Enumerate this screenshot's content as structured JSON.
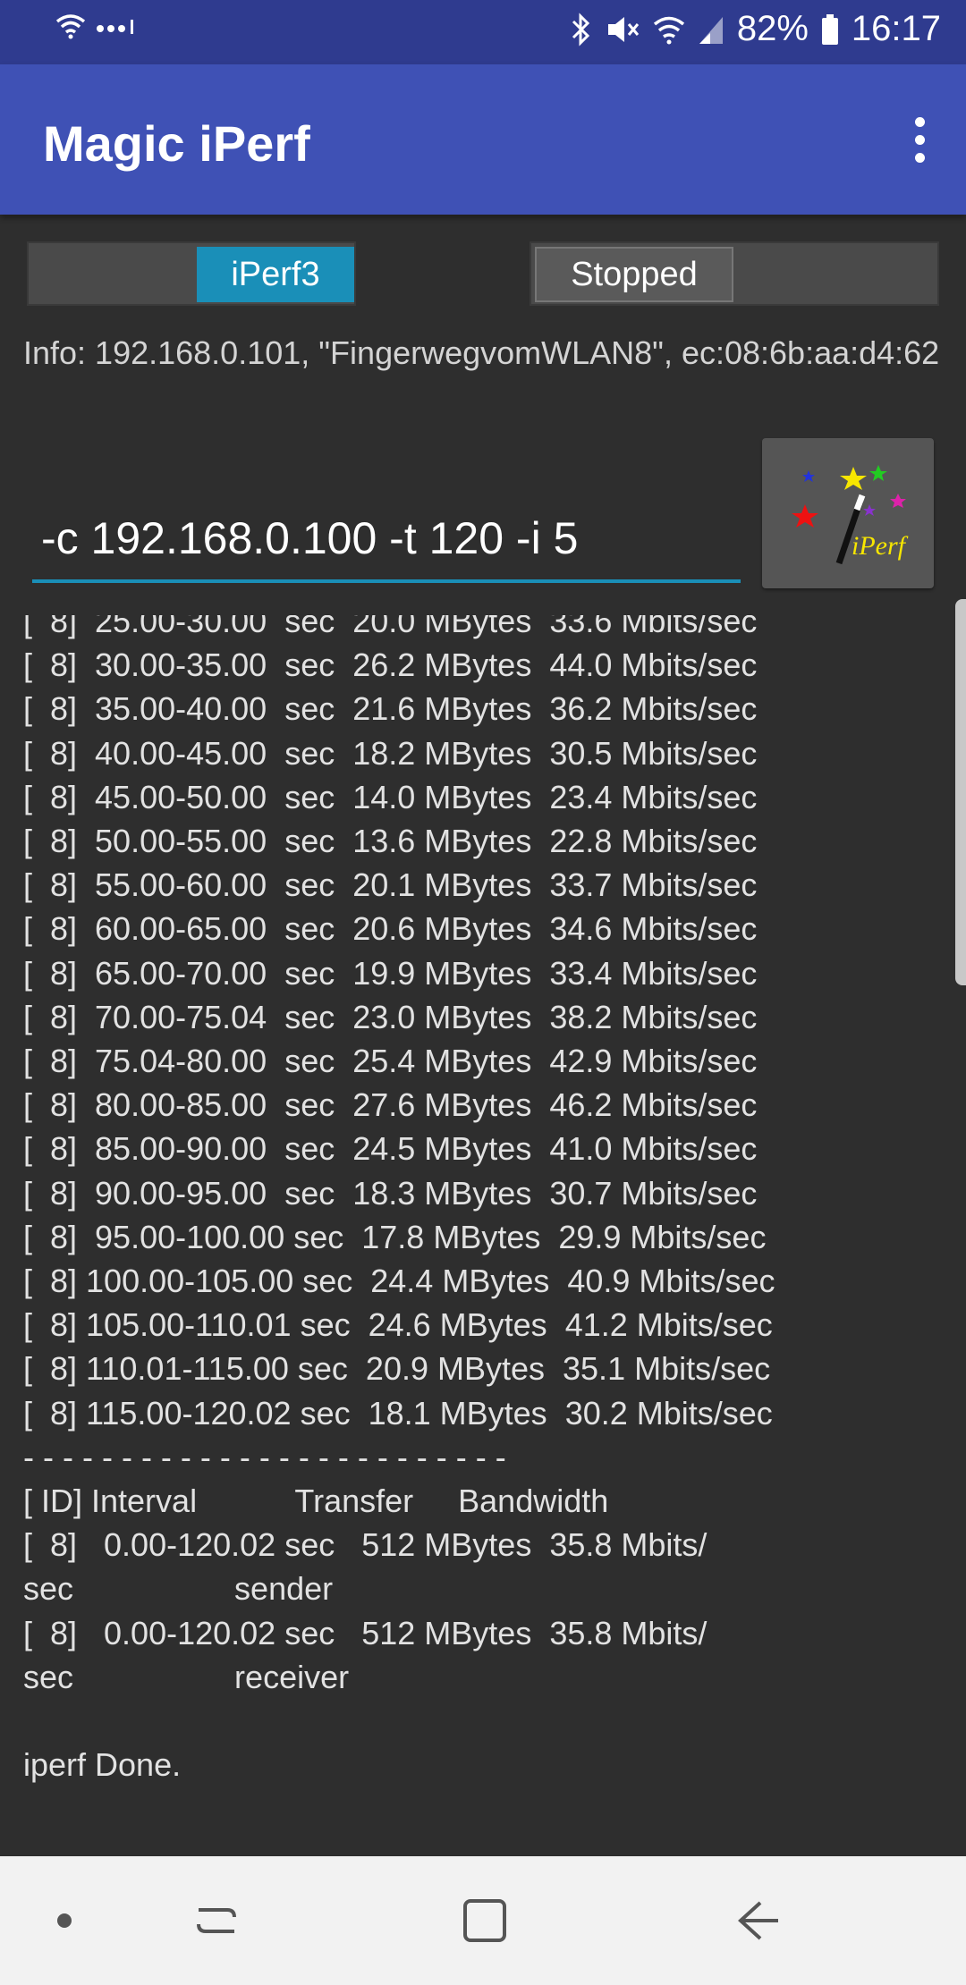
{
  "status_bar": {
    "battery": "82%",
    "time": "16:17",
    "icons": [
      "wifi-icon",
      "more-dots-icon",
      "bluetooth-icon",
      "mute-icon",
      "wifi-signal-icon",
      "cell-signal-icon",
      "battery-icon"
    ]
  },
  "app_bar": {
    "title": "Magic iPerf",
    "menu_icon": "overflow-menu-icon"
  },
  "toggles": {
    "version_label": "iPerf3",
    "state_label": "Stopped"
  },
  "info": {
    "text": "Info: 192.168.0.101, \"FingerwegvomWLAN8\", ec:08:6b:aa:d4:62"
  },
  "command": {
    "value": "-c 192.168.0.100 -t 120 -i 5"
  },
  "logo_button": {
    "text": "iPerf",
    "icon": "magic-wand-icon"
  },
  "output": {
    "text": "[  8]  25.00-30.00  sec  20.0 MBytes  33.6 Mbits/sec\n[  8]  30.00-35.00  sec  26.2 MBytes  44.0 Mbits/sec\n[  8]  35.00-40.00  sec  21.6 MBytes  36.2 Mbits/sec\n[  8]  40.00-45.00  sec  18.2 MBytes  30.5 Mbits/sec\n[  8]  45.00-50.00  sec  14.0 MBytes  23.4 Mbits/sec\n[  8]  50.00-55.00  sec  13.6 MBytes  22.8 Mbits/sec\n[  8]  55.00-60.00  sec  20.1 MBytes  33.7 Mbits/sec\n[  8]  60.00-65.00  sec  20.6 MBytes  34.6 Mbits/sec\n[  8]  65.00-70.00  sec  19.9 MBytes  33.4 Mbits/sec\n[  8]  70.00-75.04  sec  23.0 MBytes  38.2 Mbits/sec\n[  8]  75.04-80.00  sec  25.4 MBytes  42.9 Mbits/sec\n[  8]  80.00-85.00  sec  27.6 MBytes  46.2 Mbits/sec\n[  8]  85.00-90.00  sec  24.5 MBytes  41.0 Mbits/sec\n[  8]  90.00-95.00  sec  18.3 MBytes  30.7 Mbits/sec\n[  8]  95.00-100.00 sec  17.8 MBytes  29.9 Mbits/sec\n[  8] 100.00-105.00 sec  24.4 MBytes  40.9 Mbits/sec\n[  8] 105.00-110.01 sec  24.6 MBytes  41.2 Mbits/sec\n[  8] 110.01-115.00 sec  20.9 MBytes  35.1 Mbits/sec\n[  8] 115.00-120.02 sec  18.1 MBytes  30.2 Mbits/sec\n- - - - - - - - - - - - - - - - - - - - - - - - -\n[ ID] Interval           Transfer     Bandwidth\n[  8]   0.00-120.02 sec   512 MBytes  35.8 Mbits/\nsec                  sender\n[  8]   0.00-120.02 sec   512 MBytes  35.8 Mbits/\nsec                  receiver\n\niperf Done."
  },
  "nav_bar": {
    "icons": [
      "recent-apps-dot-icon",
      "recents-icon",
      "home-icon",
      "back-icon"
    ]
  },
  "colors": {
    "status_bar": "#2f3b8f",
    "app_bar": "#3f51b5",
    "accent": "#1a8fb8",
    "background": "#2e2e2e"
  }
}
